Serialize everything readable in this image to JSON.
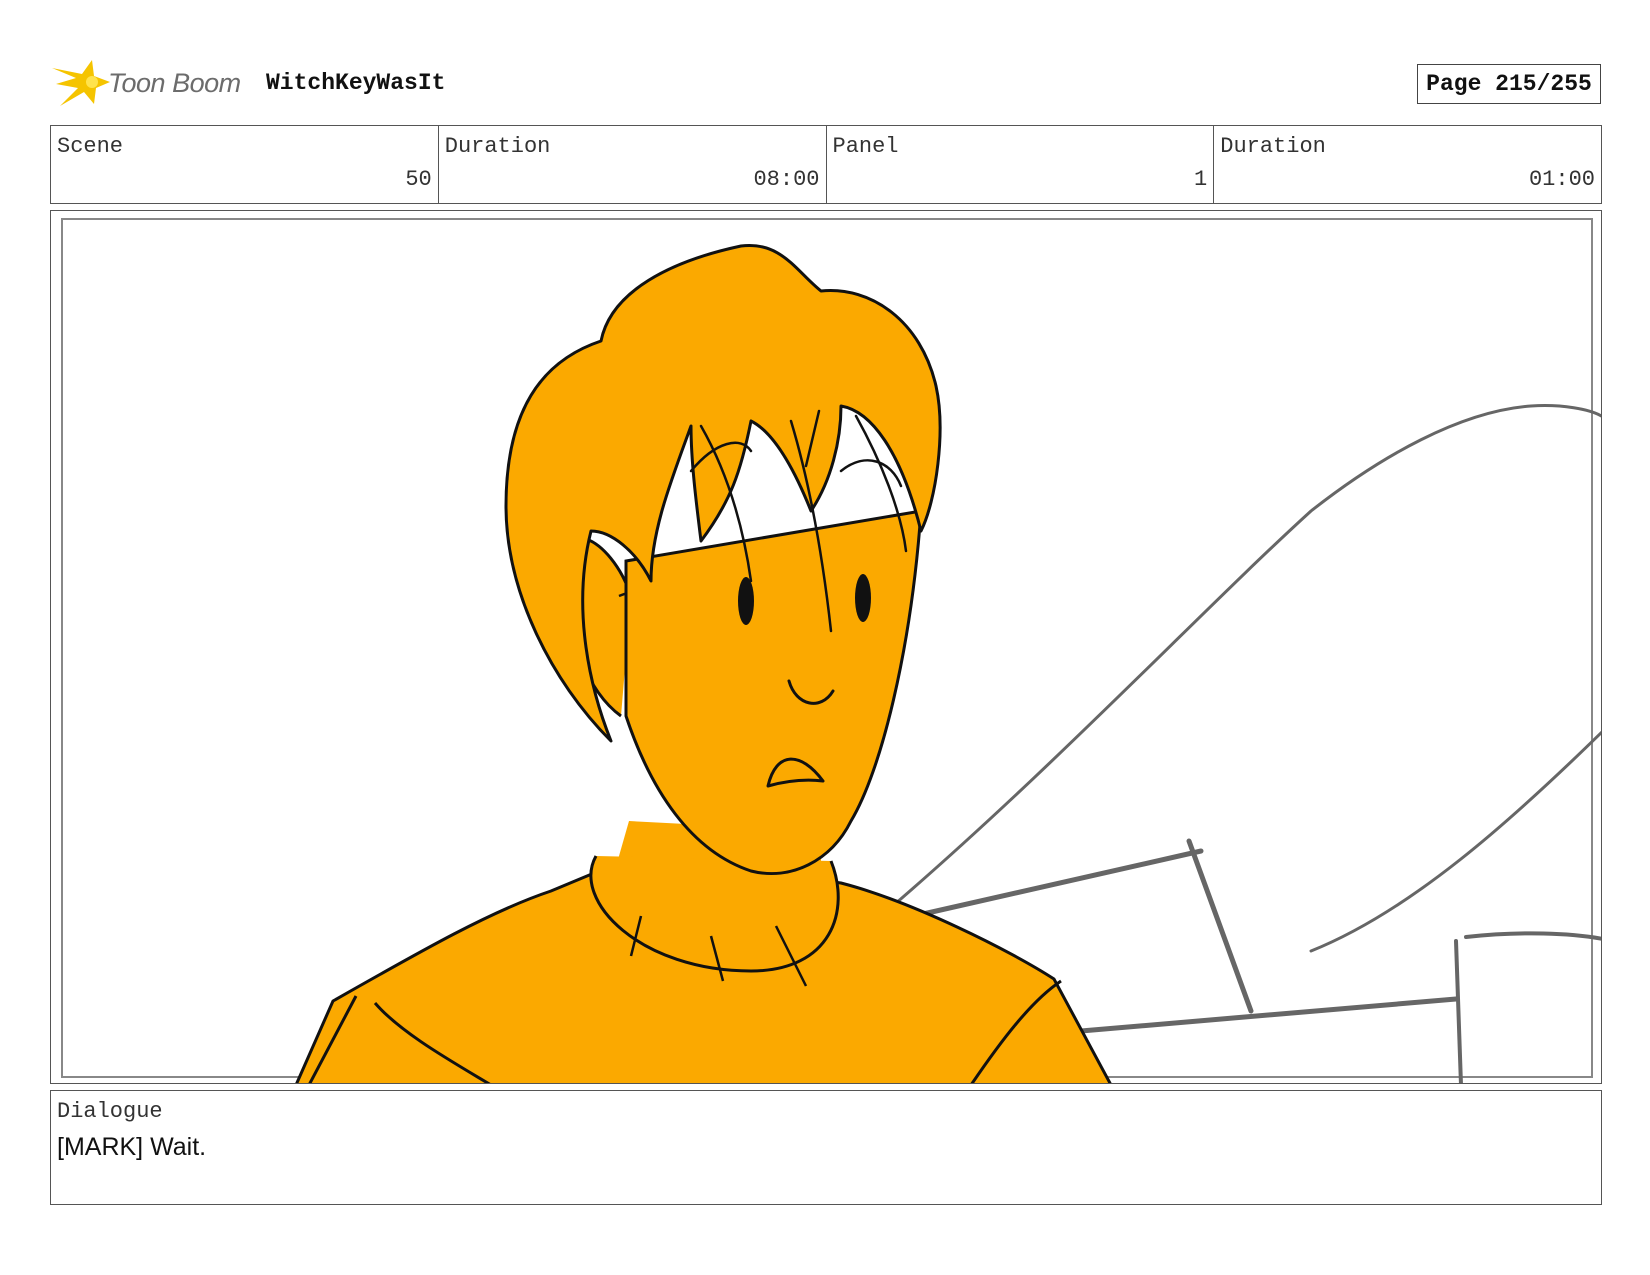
{
  "header": {
    "logo_text": "Toon Boom",
    "project_title": "WitchKeyWasIt",
    "page_indicator": "Page 215/255"
  },
  "info": {
    "scene_label": "Scene",
    "scene_value": "50",
    "scene_duration_label": "Duration",
    "scene_duration_value": "08:00",
    "panel_label": "Panel",
    "panel_value": "1",
    "panel_duration_label": "Duration",
    "panel_duration_value": "01:00"
  },
  "dialogue": {
    "label": "Dialogue",
    "text": "[MARK] Wait."
  },
  "colors": {
    "character_fill": "#FBA900",
    "ink": "#111111",
    "background_sketch": "#666666",
    "logo_star": "#F5C400"
  }
}
